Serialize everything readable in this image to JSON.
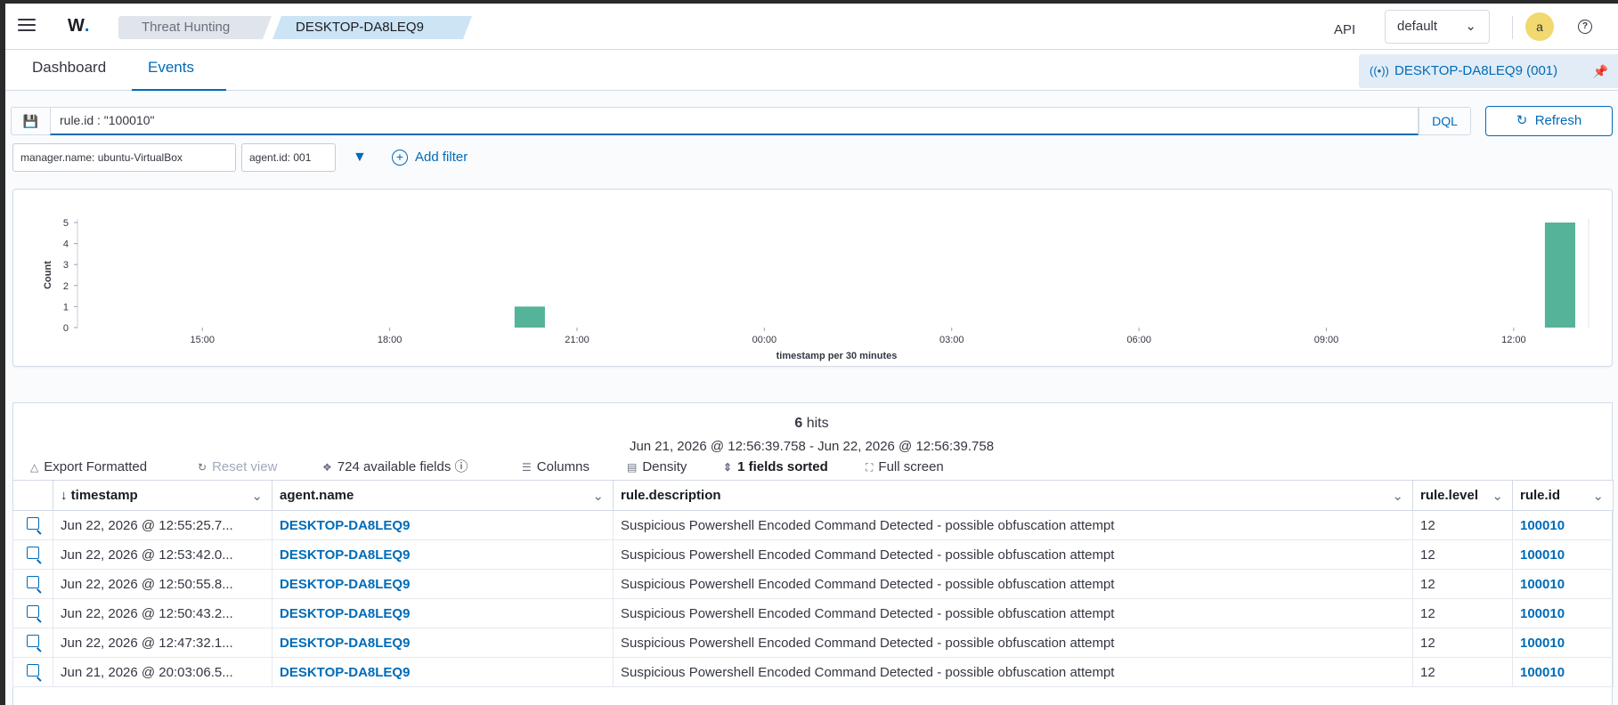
{
  "header": {
    "logo_text": "W",
    "logo_dot": ".",
    "breadcrumbs": [
      "Threat Hunting",
      "DESKTOP-DA8LEQ9"
    ],
    "api_label": "API",
    "api_selected": "default",
    "avatar_letter": "a",
    "help_glyph": "?"
  },
  "tabs": [
    "Dashboard",
    "Events"
  ],
  "pinned_agent": "DESKTOP-DA8LEQ9 (001)",
  "query": {
    "value": "rule.id : \"100010\"",
    "language": "DQL",
    "refresh_label": "Refresh"
  },
  "filters": [
    "manager.name: ubuntu-VirtualBox",
    "agent.id: 001"
  ],
  "add_filter_label": "Add filter",
  "chart_data": {
    "type": "bar",
    "xlabel": "timestamp per 30 minutes",
    "ylabel": "Count",
    "ylim": [
      0,
      5
    ],
    "yticks": [
      0,
      1,
      2,
      3,
      4,
      5
    ],
    "xticks": [
      "15:00",
      "18:00",
      "21:00",
      "00:00",
      "03:00",
      "06:00",
      "09:00",
      "12:00"
    ],
    "categories": [
      "20:00",
      "12:30"
    ],
    "values": [
      1,
      5
    ],
    "color": "#54b399"
  },
  "results": {
    "hits_count": "6",
    "hits_label": "hits",
    "time_range": "Jun 21, 2026 @ 12:56:39.758 - Jun 22, 2026 @ 12:56:39.758",
    "toolbar": {
      "export": "Export Formatted",
      "reset": "Reset view",
      "fields": "724 available fields",
      "columns": "Columns",
      "density": "Density",
      "sorted": "1 fields sorted",
      "fullscreen": "Full screen"
    },
    "columns": [
      "timestamp",
      "agent.name",
      "rule.description",
      "rule.level",
      "rule.id"
    ],
    "rows": [
      [
        "Jun 22, 2026 @ 12:55:25.7...",
        "DESKTOP-DA8LEQ9",
        "Suspicious Powershell Encoded Command Detected - possible obfuscation attempt",
        "12",
        "100010"
      ],
      [
        "Jun 22, 2026 @ 12:53:42.0...",
        "DESKTOP-DA8LEQ9",
        "Suspicious Powershell Encoded Command Detected - possible obfuscation attempt",
        "12",
        "100010"
      ],
      [
        "Jun 22, 2026 @ 12:50:55.8...",
        "DESKTOP-DA8LEQ9",
        "Suspicious Powershell Encoded Command Detected - possible obfuscation attempt",
        "12",
        "100010"
      ],
      [
        "Jun 22, 2026 @ 12:50:43.2...",
        "DESKTOP-DA8LEQ9",
        "Suspicious Powershell Encoded Command Detected - possible obfuscation attempt",
        "12",
        "100010"
      ],
      [
        "Jun 22, 2026 @ 12:47:32.1...",
        "DESKTOP-DA8LEQ9",
        "Suspicious Powershell Encoded Command Detected - possible obfuscation attempt",
        "12",
        "100010"
      ],
      [
        "Jun 21, 2026 @ 20:03:06.5...",
        "DESKTOP-DA8LEQ9",
        "Suspicious Powershell Encoded Command Detected - possible obfuscation attempt",
        "12",
        "100010"
      ]
    ]
  }
}
